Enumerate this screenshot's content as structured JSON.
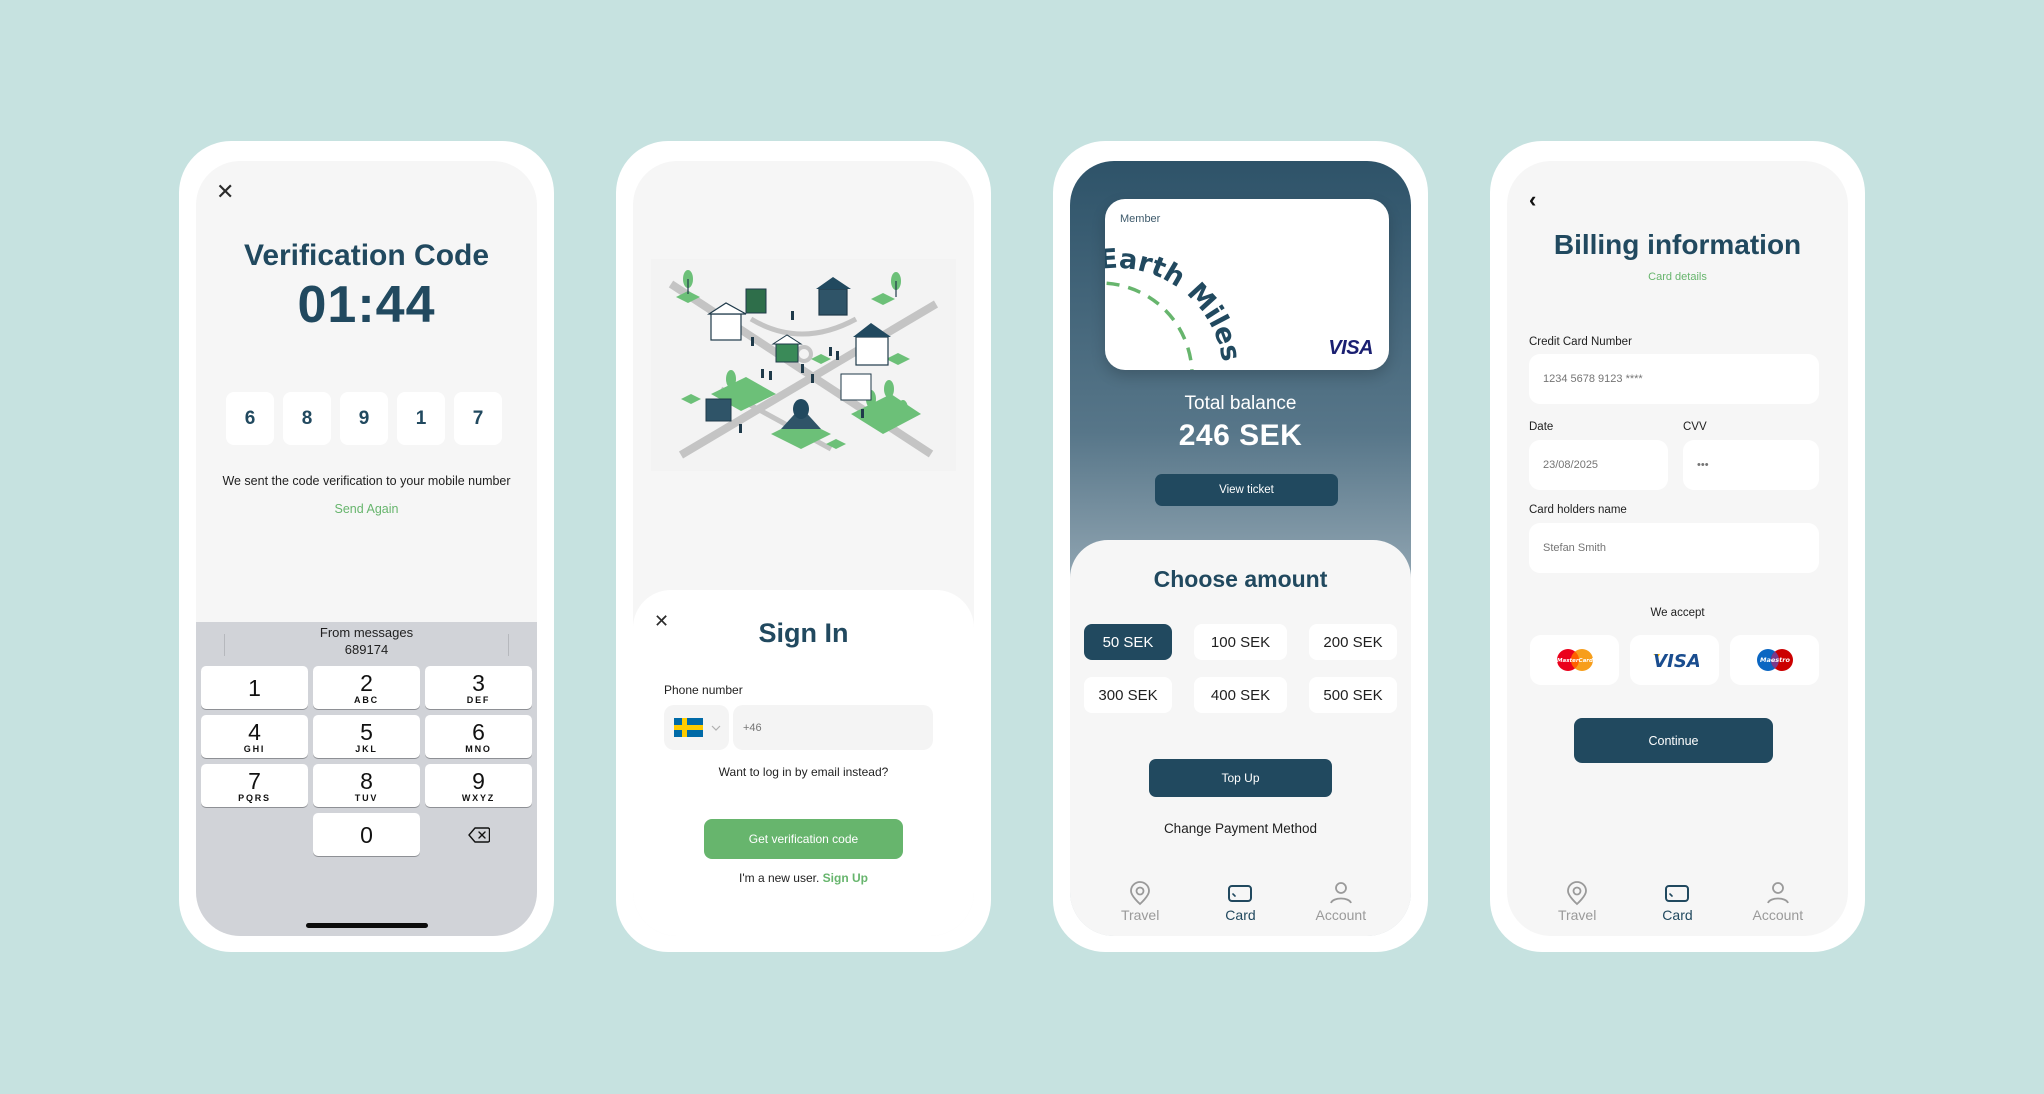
{
  "verification": {
    "close_icon": "close-icon",
    "title": "Verification Code",
    "timer": "01:44",
    "code_digits": [
      "6",
      "8",
      "9",
      "1",
      "7"
    ],
    "info_text": "We sent the code verification to your mobile number",
    "send_again": "Send Again",
    "keyboard": {
      "suggestion_label": "From messages",
      "suggestion_code": "689174",
      "keys": [
        {
          "num": "1",
          "letters": ""
        },
        {
          "num": "2",
          "letters": "ABC"
        },
        {
          "num": "3",
          "letters": "DEF"
        },
        {
          "num": "4",
          "letters": "GHI"
        },
        {
          "num": "5",
          "letters": "JKL"
        },
        {
          "num": "6",
          "letters": "MNO"
        },
        {
          "num": "7",
          "letters": "PQRS"
        },
        {
          "num": "8",
          "letters": "TUV"
        },
        {
          "num": "9",
          "letters": "WXYZ"
        },
        {
          "num": "0",
          "letters": ""
        }
      ],
      "delete_icon": "backspace-icon"
    }
  },
  "signin": {
    "illustration": "isometric-city-illustration",
    "close_icon": "close-icon",
    "title": "Sign In",
    "phone_label": "Phone number",
    "country_flag": "sweden-flag-icon",
    "phone_placeholder": "+46",
    "email_link": "Want to log in by email instead?",
    "get_code_button": "Get verification code",
    "new_user_text": "I'm a new user.",
    "sign_up_link": "Sign Up"
  },
  "card": {
    "member_label": "Member",
    "brand": "Earth Miles.",
    "network": "VISA",
    "balance_label": "Total balance",
    "balance_value": "246 SEK",
    "view_ticket_button": "View ticket",
    "choose_title": "Choose amount",
    "amounts": [
      "50 SEK",
      "100 SEK",
      "200 SEK",
      "300 SEK",
      "400 SEK",
      "500 SEK"
    ],
    "selected_amount": "50 SEK",
    "top_up_button": "Top Up",
    "change_payment": "Change Payment Method"
  },
  "billing": {
    "back_icon": "chevron-left-icon",
    "title": "Billing information",
    "subtitle": "Card details",
    "card_number_label": "Credit Card Number",
    "card_number_placeholder": "1234 5678 9123 ****",
    "date_label": "Date",
    "date_placeholder": "23/08/2025",
    "cvv_label": "CVV",
    "cvv_placeholder": "•••",
    "holder_label": "Card holders name",
    "holder_placeholder": "Stefan Smith",
    "accept_label": "We accept",
    "accepted_cards": [
      "MasterCard",
      "VISA",
      "Maestro"
    ],
    "continue_button": "Continue"
  },
  "tabbar": {
    "items": [
      {
        "label": "Travel",
        "icon": "location-pin-icon"
      },
      {
        "label": "Card",
        "icon": "card-icon",
        "active": true
      },
      {
        "label": "Account",
        "icon": "user-icon"
      }
    ]
  },
  "colors": {
    "background": "#c6e2e0",
    "navy": "#21495f",
    "green": "#67b56d",
    "screen": "#f6f6f6"
  }
}
